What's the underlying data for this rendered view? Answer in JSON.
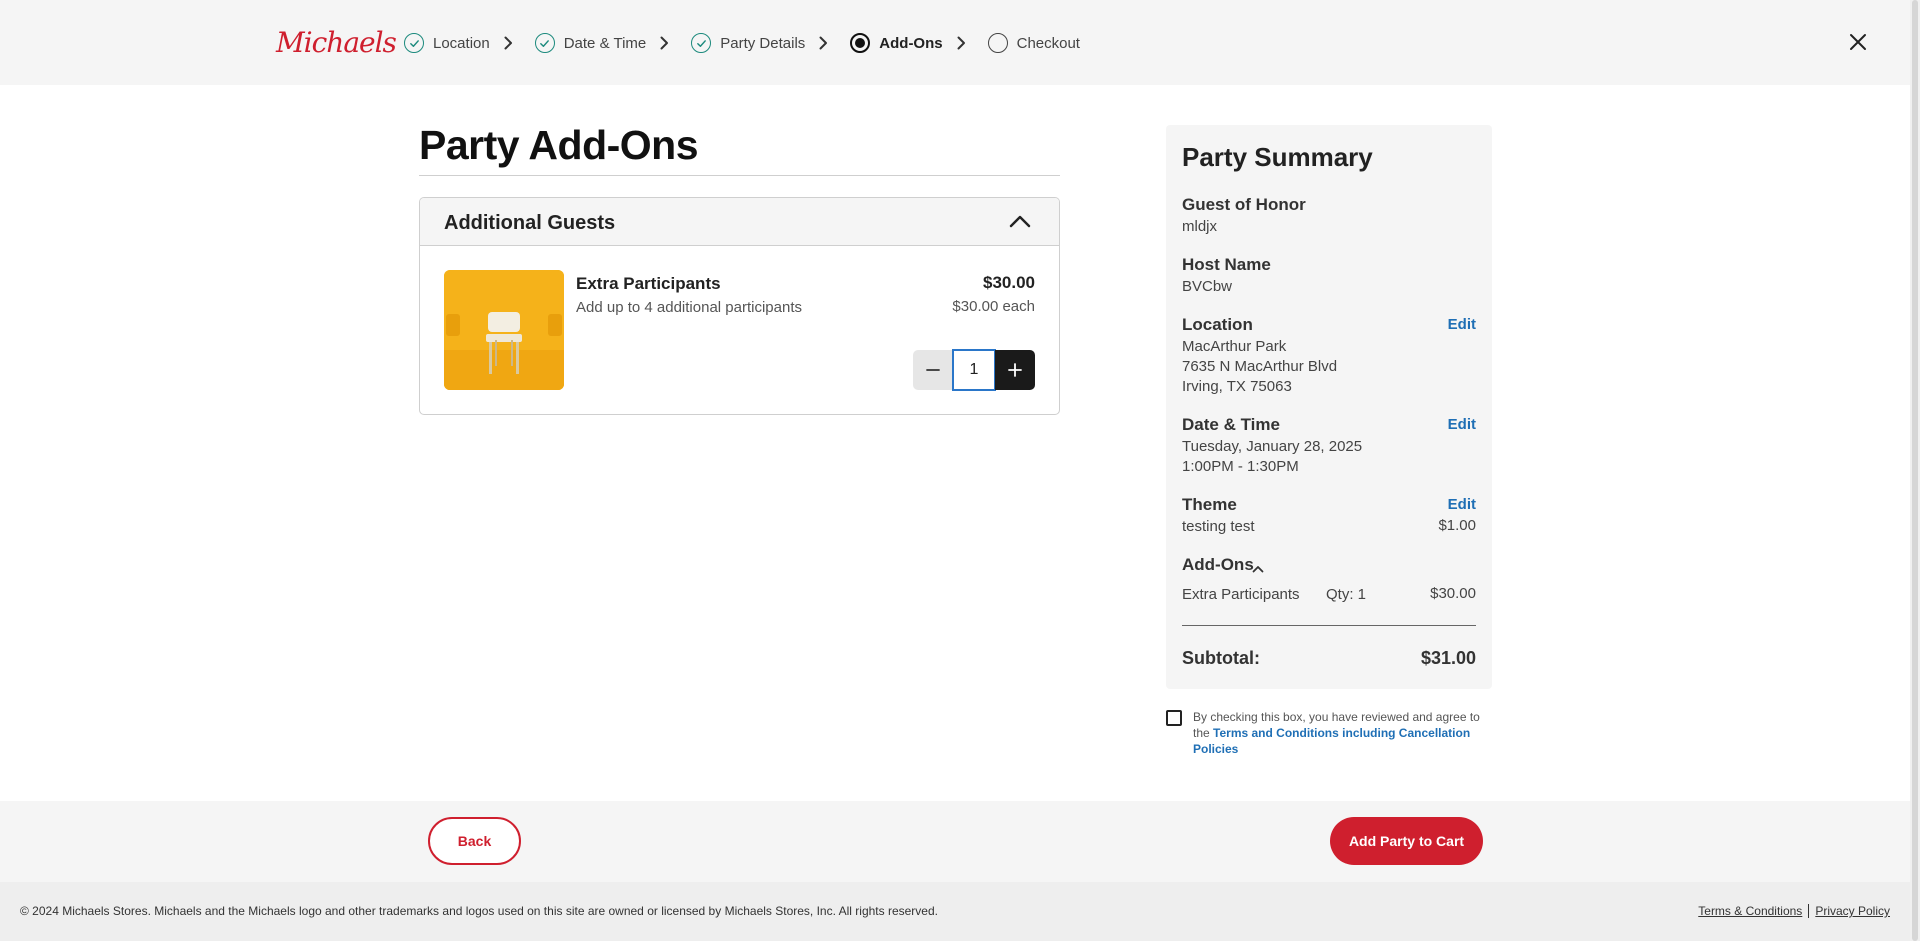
{
  "brand": {
    "logo_text": "Michaels",
    "color": "#cf1f2e"
  },
  "steps": [
    {
      "label": "Location",
      "state": "complete"
    },
    {
      "label": "Date & Time",
      "state": "complete"
    },
    {
      "label": "Party Details",
      "state": "complete"
    },
    {
      "label": "Add-Ons",
      "state": "active"
    },
    {
      "label": "Checkout",
      "state": "pending"
    }
  ],
  "page": {
    "title": "Party Add-Ons"
  },
  "addons_section": {
    "title": "Additional Guests",
    "item": {
      "name": "Extra Participants",
      "description": "Add up to 4 additional participants",
      "price": "$30.00",
      "unit_price": "$30.00 each",
      "quantity": "1"
    }
  },
  "summary": {
    "title": "Party Summary",
    "guest_of_honor_label": "Guest of Honor",
    "guest_of_honor": "mldjx",
    "host_name_label": "Host Name",
    "host_name": "BVCbw",
    "location_label": "Location",
    "location_line1": "MacArthur Park",
    "location_line2": "7635 N MacArthur Blvd",
    "location_line3": "Irving, TX 75063",
    "date_time_label": "Date & Time",
    "date": "Tuesday, January 28, 2025",
    "time": "1:00PM - 1:30PM",
    "theme_label": "Theme",
    "theme": "testing test",
    "theme_price": "$1.00",
    "edit_label": "Edit",
    "addons_label": "Add-Ons",
    "addon_name": "Extra Participants",
    "addon_qty": "Qty: 1",
    "addon_price": "$30.00",
    "subtotal_label": "Subtotal:",
    "subtotal": "$31.00"
  },
  "agreement": {
    "text": "By checking this box, you have reviewed and agree to the",
    "link": "Terms and Conditions including Cancellation Policies"
  },
  "actions": {
    "back": "Back",
    "add_to_cart": "Add Party to Cart"
  },
  "footer": {
    "copyright": "© 2024 Michaels Stores. Michaels and the Michaels logo and other trademarks and logos used on this site are owned or licensed by Michaels Stores, Inc. All rights reserved.",
    "terms": "Terms & Conditions",
    "privacy": "Privacy Policy"
  },
  "colors": {
    "accent": "#cf1f2e",
    "check": "#1c8a7d",
    "link": "#1f6fb5"
  }
}
